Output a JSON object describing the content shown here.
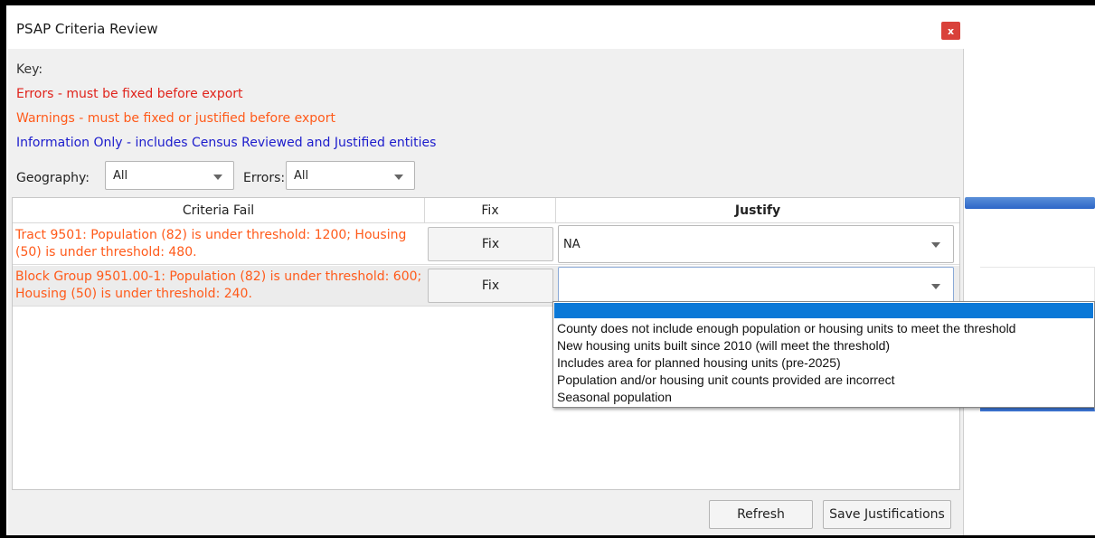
{
  "window": {
    "title": "PSAP Criteria Review",
    "close_label": "x"
  },
  "key": {
    "title": "Key:",
    "errors": "Errors - must be fixed before export",
    "warnings": "Warnings - must be fixed or justified before export",
    "info": "Information Only - includes Census Reviewed and Justified entities"
  },
  "filters": {
    "geography_label": "Geography:",
    "geography_value": "All",
    "errors_label": "Errors:",
    "errors_value": "All"
  },
  "table": {
    "headers": [
      "Criteria Fail",
      "Fix",
      "Justify"
    ],
    "rows": [
      {
        "criteria": "Tract 9501: Population (82) is under threshold: 1200; Housing (50) is under threshold: 480.",
        "fix_label": "Fix",
        "justify_value": "NA"
      },
      {
        "criteria": "Block Group 9501.00-1: Population (82) is under threshold: 600; Housing (50) is under threshold: 240.",
        "fix_label": "Fix",
        "justify_value": ""
      }
    ]
  },
  "dropdown": {
    "options": [
      "",
      "County does not include enough population or housing units to meet the threshold",
      "New housing units built since 2010 (will meet the threshold)",
      "Includes area for planned housing units (pre-2025)",
      "Population and/or housing unit counts provided are incorrect",
      "Seasonal population"
    ]
  },
  "footer": {
    "refresh_label": "Refresh",
    "save_label": "Save Justifications"
  },
  "colors": {
    "error": "#e0231b",
    "warning": "#ff5a1a",
    "info": "#1c1ccc",
    "selection": "#0a78d7",
    "close": "#d9413a"
  }
}
